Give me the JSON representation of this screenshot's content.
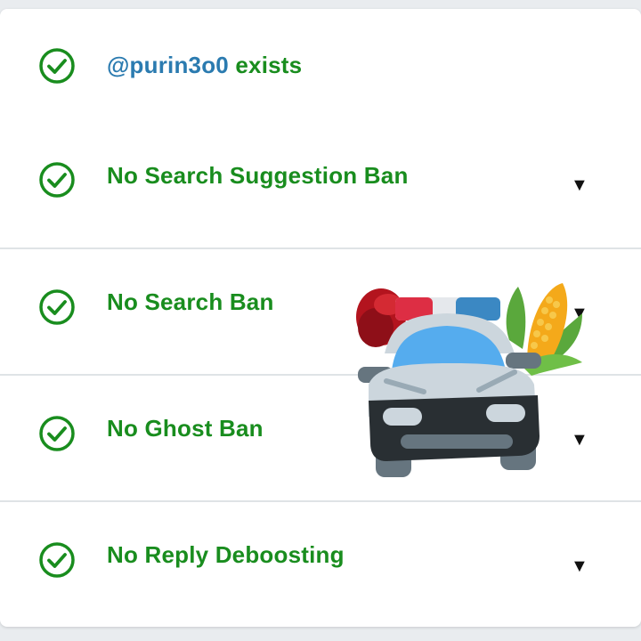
{
  "results": {
    "exists": {
      "handle": "@purin3o0",
      "suffix": " exists"
    },
    "items": [
      {
        "label": "No Search Suggestion Ban",
        "expand_icon": "▼"
      },
      {
        "label": "No Search Ban",
        "expand_icon": "▼"
      },
      {
        "label": "No Ghost Ban",
        "expand_icon": "▼"
      },
      {
        "label": "No Reply Deboosting",
        "expand_icon": "▼"
      }
    ]
  },
  "colors": {
    "pass_green": "#198d1e",
    "handle_blue": "#2b7bb0",
    "divider": "#dfe3e6"
  },
  "icons": {
    "status": "check-circle-icon",
    "expand": "triangle-down-icon",
    "overlay": "police-car-emoji"
  }
}
